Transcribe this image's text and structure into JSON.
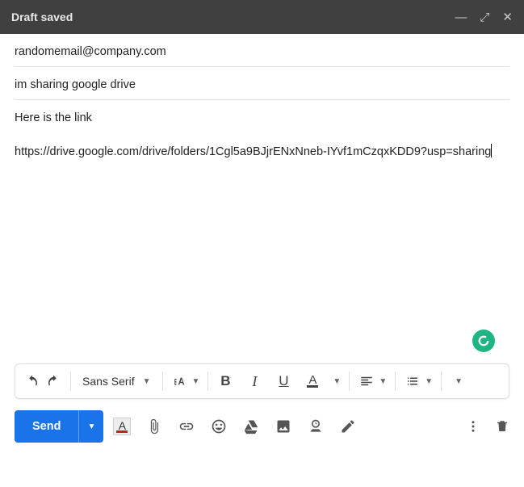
{
  "titlebar": {
    "title": "Draft saved"
  },
  "fields": {
    "to": "randomemail@company.com",
    "subject": "im sharing google drive"
  },
  "body": {
    "line1": "Here is the link",
    "url": "https://drive.google.com/drive/folders/1Cgl5a9BJjrENxNneb-IYvf1mCzqxKDD9?usp=sharing"
  },
  "format": {
    "font": "Sans Serif",
    "bold": "B",
    "italic": "I",
    "underline": "U",
    "textcolor": "A",
    "align_tip": "Align",
    "list_tip": "List"
  },
  "send": {
    "label": "Send"
  },
  "icons": {
    "undo": "undo",
    "redo": "redo",
    "size": "text-size",
    "textcolor": "text-color",
    "attach": "paperclip",
    "link": "link",
    "emoji": "emoji",
    "drive": "drive",
    "image": "image",
    "timed": "schedule",
    "pen": "ink",
    "more": "more",
    "trash": "trash"
  }
}
